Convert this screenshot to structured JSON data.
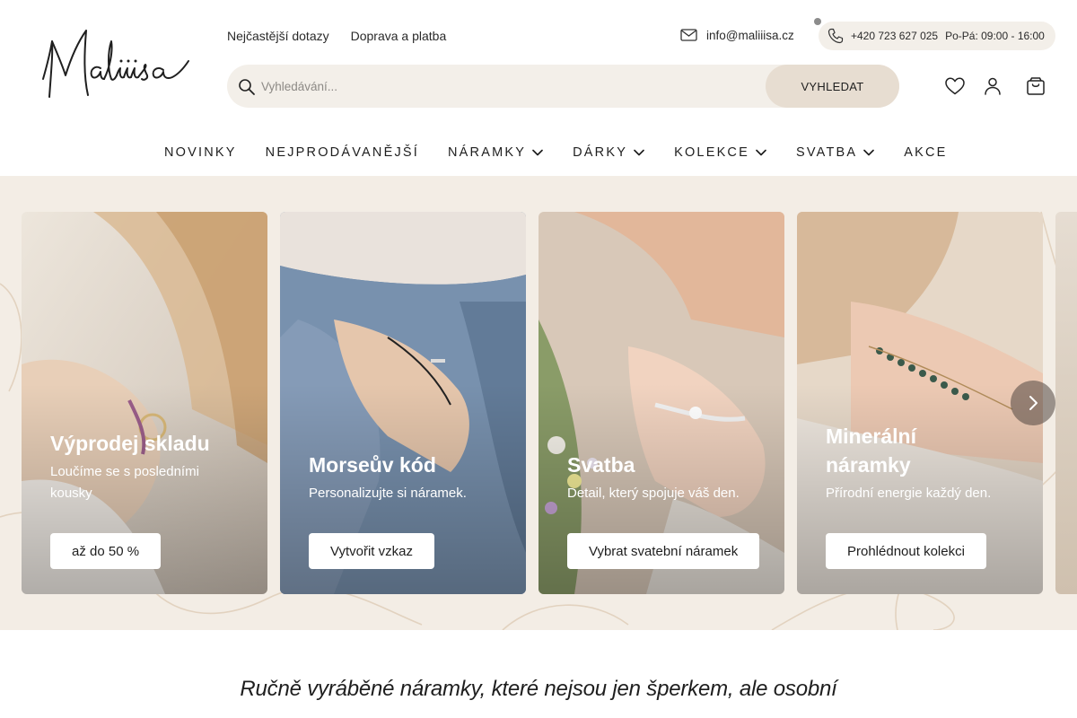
{
  "brand": {
    "logo_text": "Maliiisa"
  },
  "top_links": [
    {
      "label": "Nejčastější dotazy"
    },
    {
      "label": "Doprava a platba"
    }
  ],
  "contact": {
    "email": "info@maliiisa.cz",
    "phone": "+420 723 627 025",
    "hours": "Po-Pá: 09:00 - 16:00"
  },
  "search": {
    "placeholder": "Vyhledávání...",
    "button_label": "VYHLEDAT"
  },
  "header_icons": [
    "heart-icon",
    "user-icon",
    "cart-icon"
  ],
  "nav": [
    {
      "label": "NOVINKY",
      "has_dropdown": false
    },
    {
      "label": "NEJPRODÁVANĚJŠÍ",
      "has_dropdown": false
    },
    {
      "label": "NÁRAMKY",
      "has_dropdown": true
    },
    {
      "label": "DÁRKY",
      "has_dropdown": true
    },
    {
      "label": "KOLEKCE",
      "has_dropdown": true
    },
    {
      "label": "SVATBA",
      "has_dropdown": true
    },
    {
      "label": "AKCE",
      "has_dropdown": false
    }
  ],
  "cards": [
    {
      "title": "Výprodej skladu",
      "subtitle": "Loučíme se s posledními kousky",
      "button": "až do 50 %"
    },
    {
      "title": "Morseův kód",
      "subtitle": "Personalizujte si náramek.",
      "button": "Vytvořit vzkaz"
    },
    {
      "title": "Svatba",
      "subtitle": "Detail, který spojuje váš den.",
      "button": "Vybrat svatební náramek"
    },
    {
      "title": "Minerální náramky",
      "subtitle": "Přírodní energie každý den.",
      "button": "Prohlédnout kolekci"
    }
  ],
  "carousel": {
    "next_icon": "chevron-right-icon"
  },
  "tagline": "Ručně vyráběné náramky, které nejsou jen šperkem, ale osobní",
  "colors": {
    "band_bg": "#f3ede5",
    "pill_bg": "#f3efe9",
    "search_button_bg": "#e7ddd1",
    "text": "#1e1e1e"
  }
}
